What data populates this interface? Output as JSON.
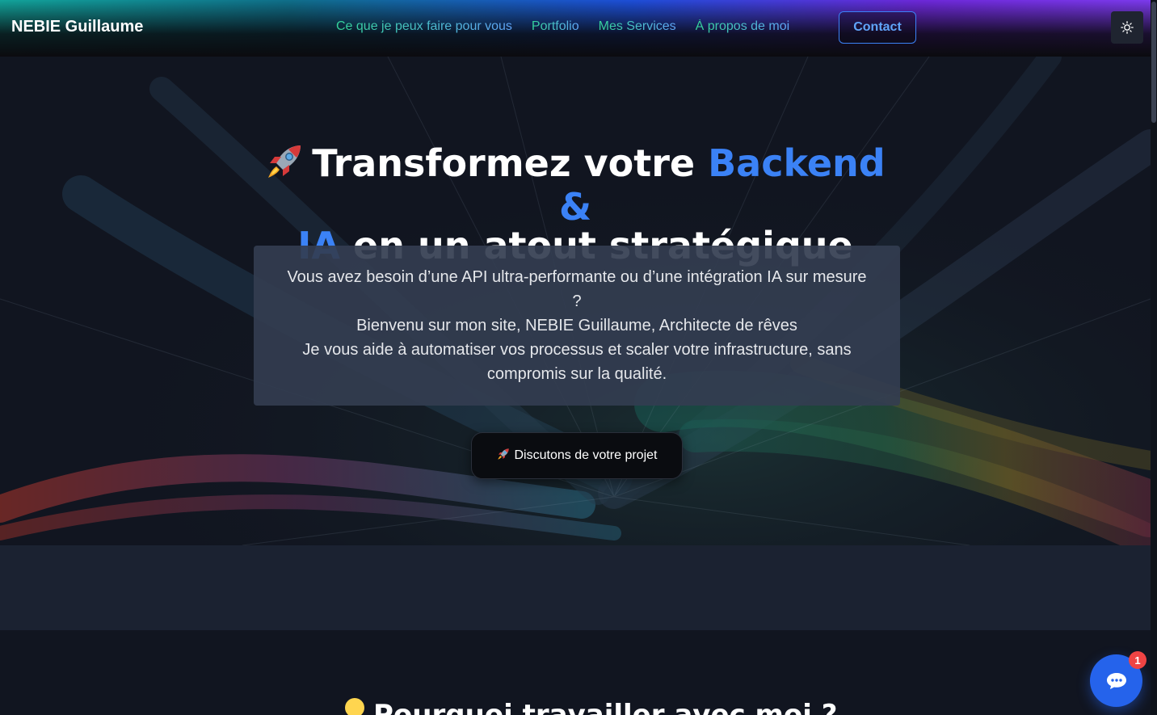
{
  "navbar": {
    "brand": "NEBIE Guillaume",
    "links": [
      {
        "label": "Ce que je peux faire pour vous"
      },
      {
        "label": "Portfolio"
      },
      {
        "label": "Mes Services"
      },
      {
        "label": "À propos de moi"
      }
    ],
    "contact_label": "Contact",
    "theme_icon": "sun-icon"
  },
  "hero": {
    "title_emoji": "rocket-icon",
    "title_part1": "Transformez votre ",
    "title_accent1": "Backend &",
    "title_accent2": "IA",
    "title_part2": " en un atout stratégique",
    "intro_lines": [
      "Vous avez besoin d’une API ultra-performante ou d’une intégration IA sur mesure ?",
      "Bienvenu sur mon site, NEBIE Guillaume, Architecte de rêves",
      "Je vous aide à automatiser vos processus et scaler votre infrastructure, sans compromis sur la qualité."
    ],
    "cta_label": "Discutons de votre projet"
  },
  "section_why": {
    "title_emoji": "lightbulb-icon",
    "title": "Pourquoi travailler avec moi ?"
  },
  "chat": {
    "icon": "chat-bubble-icon",
    "badge_count": "1"
  },
  "colors": {
    "accent": "#3b82f6",
    "chat": "#2563eb",
    "badge": "#ef4444"
  }
}
